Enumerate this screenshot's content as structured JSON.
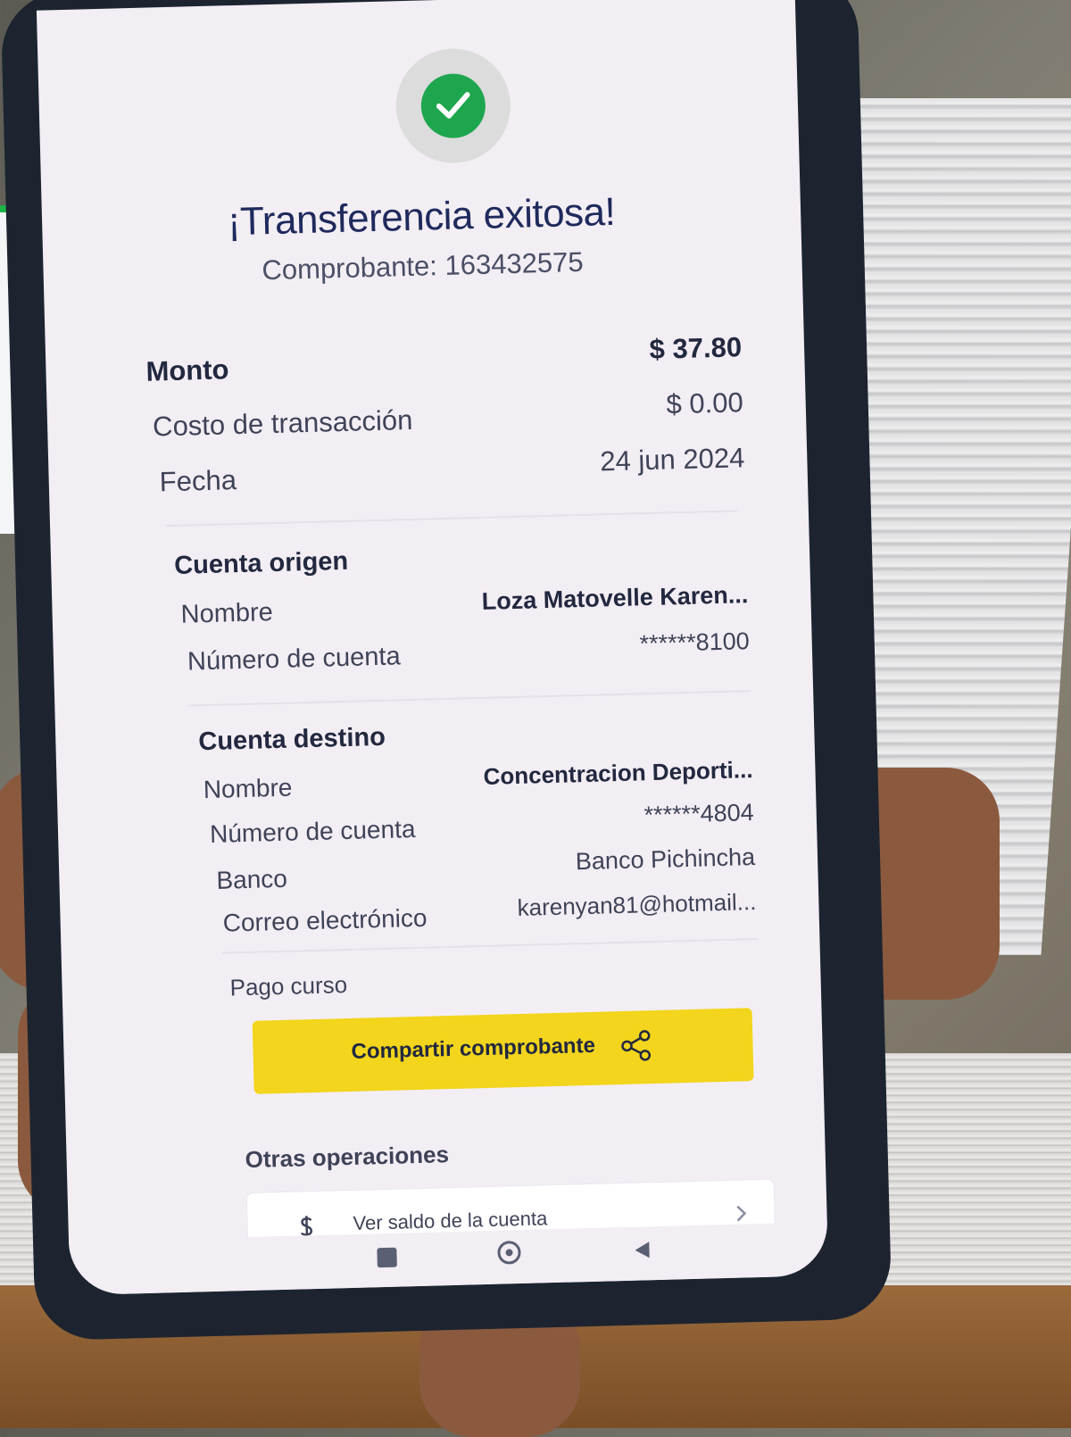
{
  "receipt": {
    "title": "¡Transferencia exitosa!",
    "voucher": "Comprobante: 163432575",
    "amount_label": "Monto",
    "amount_value": "$ 37.80",
    "fee_label": "Costo de transacción",
    "fee_value": "$ 0.00",
    "date_label": "Fecha",
    "date_value": "24 jun 2024"
  },
  "origin": {
    "title": "Cuenta origen",
    "name_label": "Nombre",
    "name_value": "Loza  Matovelle Karen...",
    "account_label": "Número de cuenta",
    "account_value": "******8100"
  },
  "destination": {
    "title": "Cuenta destino",
    "name_label": "Nombre",
    "name_value": "Concentracion Deporti...",
    "account_label": "Número de cuenta",
    "account_value": "******4804",
    "bank_label": "Banco",
    "bank_value": "Banco Pichincha",
    "email_label": "Correo electrónico",
    "email_value": "karenyan81@hotmail..."
  },
  "description": "Pago curso",
  "share_button": {
    "label": "Compartir comprobante",
    "icon": "share-icon"
  },
  "other_operations": {
    "title": "Otras operaciones",
    "items": [
      {
        "label": "Ver saldo de la cuenta",
        "icon": "dollar-icon"
      }
    ]
  },
  "colors": {
    "success": "#1ea64f",
    "accent": "#f2d51c",
    "text_primary": "#1f2a5c"
  }
}
